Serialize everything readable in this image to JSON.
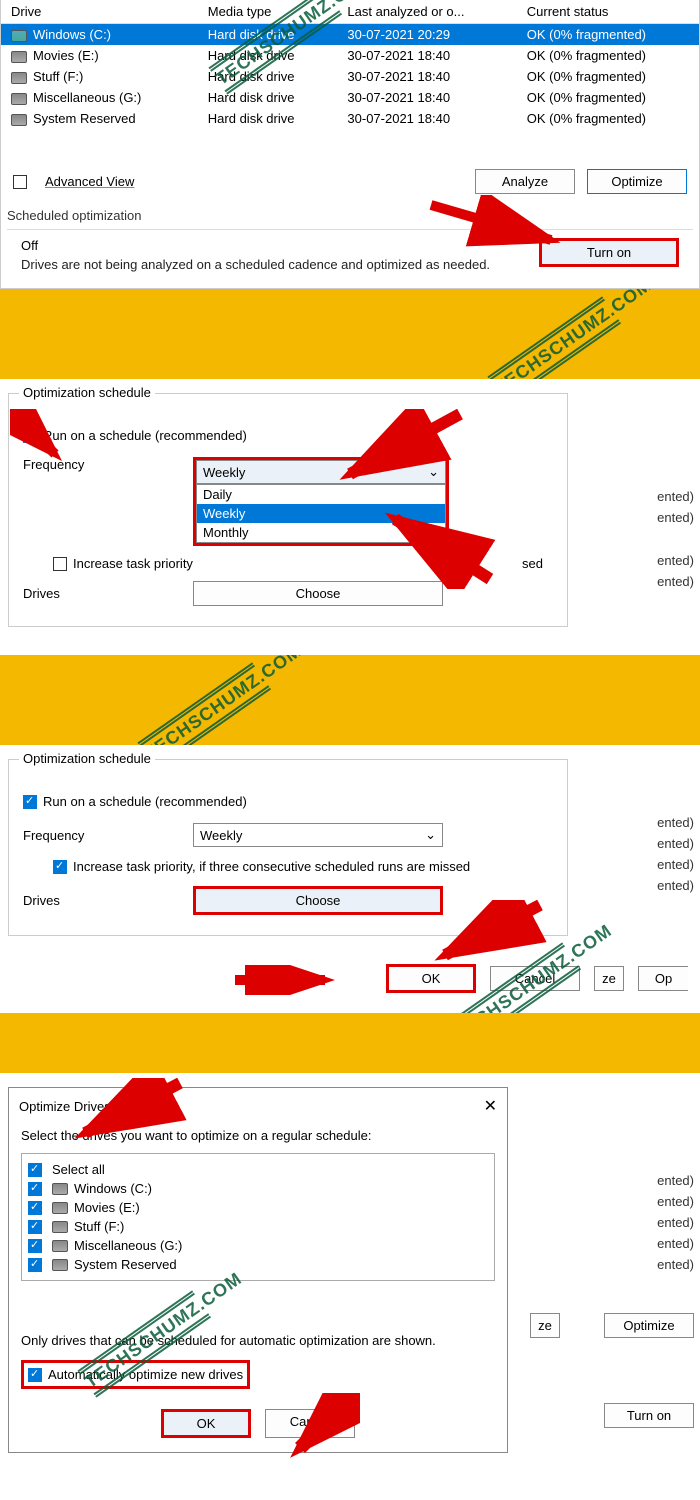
{
  "top": {
    "headers": [
      "Drive",
      "Media type",
      "Last analyzed or o...",
      "Current status"
    ],
    "rows": [
      {
        "name": "Windows (C:)",
        "media": "Hard disk drive",
        "date": "30-07-2021 20:29",
        "status": "OK (0% fragmented)",
        "selected": true,
        "icon": "win"
      },
      {
        "name": "Movies (E:)",
        "media": "Hard disk drive",
        "date": "30-07-2021 18:40",
        "status": "OK (0% fragmented)"
      },
      {
        "name": "Stuff (F:)",
        "media": "Hard disk drive",
        "date": "30-07-2021 18:40",
        "status": "OK (0% fragmented)"
      },
      {
        "name": "Miscellaneous (G:)",
        "media": "Hard disk drive",
        "date": "30-07-2021 18:40",
        "status": "OK (0% fragmented)"
      },
      {
        "name": "System Reserved",
        "media": "Hard disk drive",
        "date": "30-07-2021 18:40",
        "status": "OK (0% fragmented)"
      }
    ],
    "advanced_view": "Advanced View",
    "analyze": "Analyze",
    "optimize": "Optimize",
    "sched_title": "Scheduled optimization",
    "sched_state": "Off",
    "sched_desc": "Drives are not being analyzed on a scheduled cadence and optimized as needed.",
    "turn_on": "Turn on"
  },
  "watermark": "TECHSCHUMZ.COM",
  "panel2": {
    "title": "Optimization schedule",
    "run_label": "Run on a schedule (recommended)",
    "freq_label": "Frequency",
    "freq_value": "Weekly",
    "freq_options": [
      "Daily",
      "Weekly",
      "Monthly"
    ],
    "increase_label": "Increase task priority",
    "increase_suffix": "sed",
    "drives_label": "Drives",
    "choose": "Choose",
    "side_suffix": "ented)"
  },
  "panel3": {
    "title": "Optimization schedule",
    "run_label": "Run on a schedule (recommended)",
    "freq_label": "Frequency",
    "freq_value": "Weekly",
    "increase_label": "Increase task priority, if three consecutive scheduled runs are missed",
    "drives_label": "Drives",
    "choose": "Choose",
    "ok": "OK",
    "cancel": "Cancel",
    "side_btn_ze": "ze",
    "side_btn_op": "Op",
    "side_suffix": "ented)"
  },
  "panel4": {
    "title": "Optimize Drives",
    "prompt": "Select the drives you want to optimize on a regular schedule:",
    "select_all": "Select all",
    "items": [
      "Windows (C:)",
      "Movies (E:)",
      "Stuff (F:)",
      "Miscellaneous (G:)",
      "System Reserved"
    ],
    "only_hint": "Only drives that can be scheduled for automatic optimization are shown.",
    "auto_label": "Automatically optimize new drives",
    "ok": "OK",
    "cancel": "Cancel",
    "side_optimize": "Optimize",
    "side_turn_on": "Turn on",
    "side_ze": "ze",
    "side_suffix": "ented)"
  }
}
